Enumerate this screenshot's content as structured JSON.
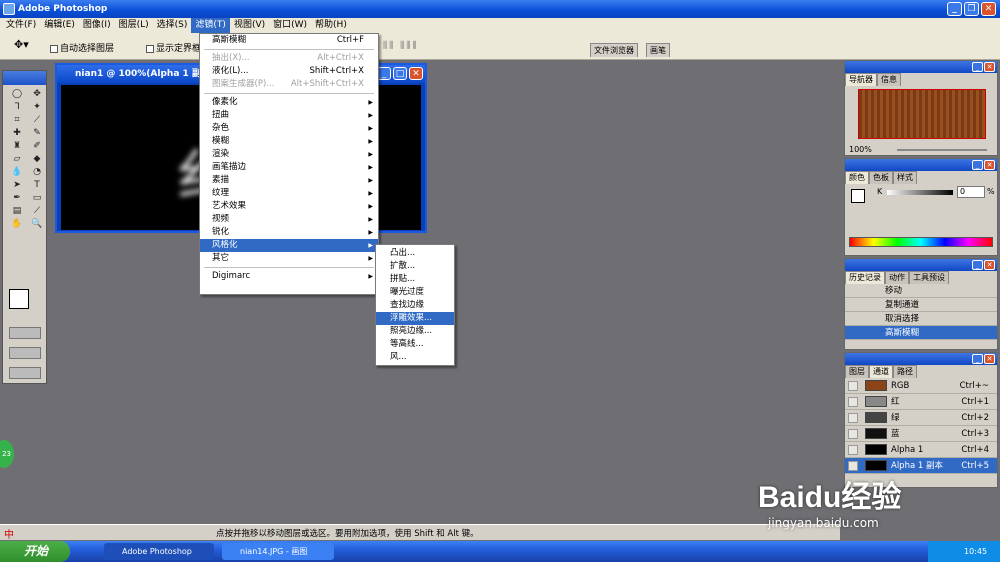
{
  "app": {
    "title": "Adobe Photoshop"
  },
  "menubar": [
    {
      "label": "文件(F)"
    },
    {
      "label": "编辑(E)"
    },
    {
      "label": "图像(I)"
    },
    {
      "label": "图层(L)"
    },
    {
      "label": "选择(S)"
    },
    {
      "label": "滤镜(T)"
    },
    {
      "label": "视图(V)"
    },
    {
      "label": "窗口(W)"
    },
    {
      "label": "帮助(H)"
    }
  ],
  "options": {
    "auto_select": "自动选择图层",
    "show_bounds": "显示定界框",
    "file_browser_tab": "文件浏览器",
    "brushes_tab": "画笔"
  },
  "document": {
    "title": "nian1 @ 100%(Alpha 1 副本)"
  },
  "filter_menu": {
    "items": [
      {
        "label": "高斯模糊",
        "shortcut": "Ctrl+F"
      },
      {
        "label": "抽出(X)...",
        "shortcut": "Alt+Ctrl+X"
      },
      {
        "label": "液化(L)...",
        "shortcut": "Shift+Ctrl+X"
      },
      {
        "label": "图案生成器(P)...",
        "shortcut": "Alt+Shift+Ctrl+X"
      },
      {
        "label": "像素化"
      },
      {
        "label": "扭曲"
      },
      {
        "label": "杂色"
      },
      {
        "label": "模糊"
      },
      {
        "label": "渲染"
      },
      {
        "label": "画笔描边"
      },
      {
        "label": "素描"
      },
      {
        "label": "纹理"
      },
      {
        "label": "艺术效果"
      },
      {
        "label": "视频"
      },
      {
        "label": "锐化"
      },
      {
        "label": "风格化"
      },
      {
        "label": "其它"
      },
      {
        "label": "Digimarc"
      }
    ]
  },
  "stylize_submenu": {
    "items": [
      {
        "label": "凸出..."
      },
      {
        "label": "扩散..."
      },
      {
        "label": "拼贴..."
      },
      {
        "label": "曝光过度"
      },
      {
        "label": "查找边缘"
      },
      {
        "label": "浮雕效果..."
      },
      {
        "label": "照亮边缘..."
      },
      {
        "label": "等高线..."
      },
      {
        "label": "风..."
      }
    ]
  },
  "navigator": {
    "tabs": [
      "导航器",
      "信息"
    ],
    "zoom": "100%"
  },
  "color": {
    "tabs": [
      "颜色",
      "色板",
      "样式"
    ],
    "channel": "K",
    "value": "0",
    "unit": "%"
  },
  "history": {
    "tabs": [
      "历史记录",
      "动作",
      "工具预设"
    ],
    "items": [
      {
        "label": "移动"
      },
      {
        "label": "复制通道"
      },
      {
        "label": "取消选择"
      },
      {
        "label": "高斯模糊"
      }
    ]
  },
  "channels": {
    "tabs": [
      "图层",
      "通道",
      "路径"
    ],
    "rows": [
      {
        "name": "RGB",
        "shortcut": "Ctrl+~"
      },
      {
        "name": "红",
        "shortcut": "Ctrl+1"
      },
      {
        "name": "绿",
        "shortcut": "Ctrl+2"
      },
      {
        "name": "蓝",
        "shortcut": "Ctrl+3"
      },
      {
        "name": "Alpha 1",
        "shortcut": "Ctrl+4"
      },
      {
        "name": "Alpha 1 副本",
        "shortcut": "Ctrl+5"
      }
    ]
  },
  "status": {
    "text": "点按并拖移以移动图层或选区。要用附加选项，使用 Shift 和 Alt 键。",
    "ime": "中"
  },
  "taskbar": {
    "start": "开始",
    "buttons": [
      {
        "label": "Adobe Photoshop"
      },
      {
        "label": "nian14.JPG - 画图"
      }
    ],
    "clock": "10:45"
  },
  "badge": {
    "number": "23"
  },
  "watermark": {
    "brand": "Baidu经验",
    "url": "jingyan.baidu.com"
  }
}
